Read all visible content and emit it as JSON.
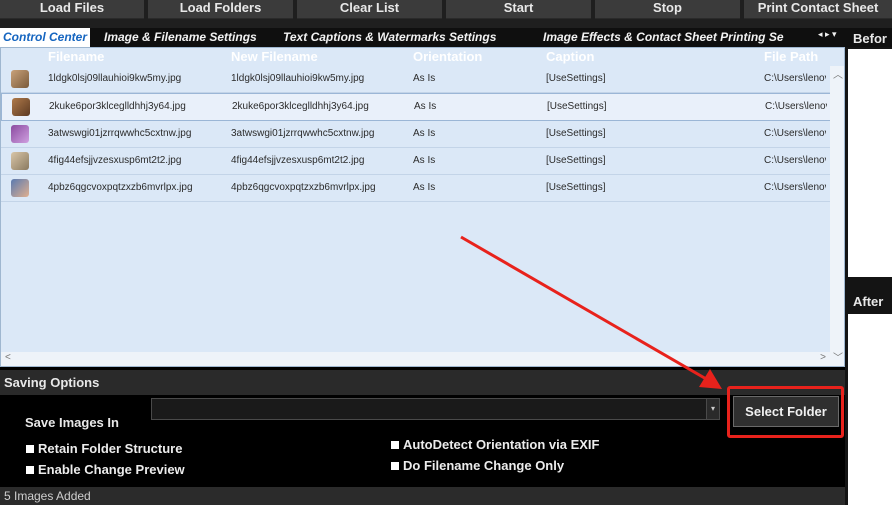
{
  "toolbar": {
    "buttons": [
      "Load Files",
      "Load Folders",
      "Clear List",
      "Start",
      "Stop",
      "Print Contact Sheet"
    ]
  },
  "tabs": [
    "Control Center",
    "Image & Filename Settings",
    "Text Captions & Watermarks Settings",
    "Image Effects & Contact Sheet Printing Se"
  ],
  "grid": {
    "columns": [
      "Filename",
      "New Filename",
      "Orientation",
      "Caption",
      "File Path"
    ],
    "rows": [
      {
        "filename": "1ldgk0lsj09llauhioi9kw5my.jpg",
        "new_filename": "1ldgk0lsj09llauhioi9kw5my.jpg",
        "orientation": "As Is",
        "caption": "[UseSettings]",
        "path": "C:\\Users\\lenov"
      },
      {
        "filename": "2kuke6por3klceglldhhj3y64.jpg",
        "new_filename": "2kuke6por3klceglldhhj3y64.jpg",
        "orientation": "As Is",
        "caption": "[UseSettings]",
        "path": "C:\\Users\\lenov"
      },
      {
        "filename": "3atwswgi01jzrrqwwhc5cxtnw.jpg",
        "new_filename": "3atwswgi01jzrrqwwhc5cxtnw.jpg",
        "orientation": "As Is",
        "caption": "[UseSettings]",
        "path": "C:\\Users\\lenov"
      },
      {
        "filename": "4fig44efsjjvzesxusp6mt2t2.jpg",
        "new_filename": "4fig44efsjjvzesxusp6mt2t2.jpg",
        "orientation": "As Is",
        "caption": "[UseSettings]",
        "path": "C:\\Users\\lenov"
      },
      {
        "filename": "4pbz6qgcvoxpqtzxzb6mvrlpx.jpg",
        "new_filename": "4pbz6qgcvoxpqtzxzb6mvrlpx.jpg",
        "orientation": "As Is",
        "caption": "[UseSettings]",
        "path": "C:\\Users\\lenov"
      }
    ]
  },
  "preview": {
    "before_label": "Befor",
    "after_label": "After"
  },
  "saving": {
    "title": "Saving Options",
    "save_label": "Save Images In",
    "path_value": "",
    "select_folder": "Select Folder",
    "options": [
      "Retain Folder Structure",
      "Enable Change Preview",
      "AutoDetect Orientation via EXIF",
      "Do Filename Change Only"
    ]
  },
  "status": "5 Images Added",
  "colors": {
    "active_tab": "#1565c0",
    "highlight": "#e8221c",
    "grid_bg": "#dbe8f7"
  }
}
